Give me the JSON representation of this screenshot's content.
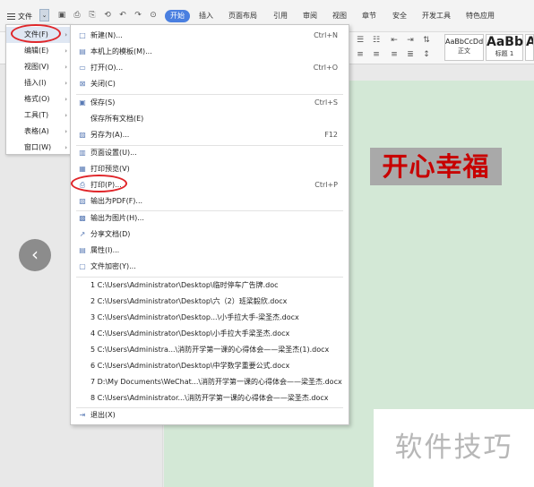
{
  "ribbon": {
    "menu_label": "文件",
    "dropdown_glyph": "⌄",
    "quick_access": [
      "▣",
      "⎙",
      "⎘",
      "⟲",
      "↶",
      "↷",
      "⊙"
    ],
    "tabs": [
      "开始",
      "插入",
      "页面布局",
      "引用",
      "审阅",
      "视图",
      "章节",
      "安全",
      "开发工具",
      "特色应用"
    ],
    "styles": [
      {
        "sample": "AaBbCcDd",
        "name": "正文"
      },
      {
        "sample": "AaBb",
        "name": "标题 1"
      },
      {
        "sample": "Aa",
        "name": ""
      }
    ]
  },
  "main_menu": {
    "items": [
      {
        "label": "文件(F)"
      },
      {
        "label": "编辑(E)"
      },
      {
        "label": "视图(V)"
      },
      {
        "label": "插入(I)"
      },
      {
        "label": "格式(O)"
      },
      {
        "label": "工具(T)"
      },
      {
        "label": "表格(A)"
      },
      {
        "label": "窗口(W)"
      }
    ],
    "arrow": "›"
  },
  "file_menu": {
    "items": [
      {
        "label": "新建(N)...",
        "shortcut": "Ctrl+N",
        "icon": "□"
      },
      {
        "label": "本机上的模板(M)...",
        "shortcut": "",
        "icon": "▤"
      },
      {
        "label": "打开(O)...",
        "shortcut": "Ctrl+O",
        "icon": "▭"
      },
      {
        "label": "关闭(C)",
        "shortcut": "",
        "icon": "⊠"
      },
      {
        "label": "保存(S)",
        "shortcut": "Ctrl+S",
        "icon": "▣"
      },
      {
        "label": "保存所有文档(E)",
        "shortcut": "",
        "icon": ""
      },
      {
        "label": "另存为(A)...",
        "shortcut": "F12",
        "icon": "▨"
      },
      {
        "label": "页面设置(U)...",
        "shortcut": "",
        "icon": "▥"
      },
      {
        "label": "打印预览(V)",
        "shortcut": "",
        "icon": "▦"
      },
      {
        "label": "打印(P)...",
        "shortcut": "Ctrl+P",
        "icon": "⎙"
      },
      {
        "label": "输出为PDF(F)...",
        "shortcut": "",
        "icon": "▧"
      },
      {
        "label": "输出为图片(H)...",
        "shortcut": "",
        "icon": "▩"
      },
      {
        "label": "分享文档(D)",
        "shortcut": "",
        "icon": "↗"
      },
      {
        "label": "属性(I)...",
        "shortcut": "",
        "icon": "▤"
      },
      {
        "label": "文件加密(Y)...",
        "shortcut": "",
        "icon": "▢"
      }
    ],
    "recent": [
      "1 C:\\Users\\Administrator\\Desktop\\临时停车广告牌.doc",
      "2 C:\\Users\\Administrator\\Desktop\\六（2）班梁毅欣.docx",
      "3 C:\\Users\\Administrator\\Desktop...\\小手拉大手-梁圣杰.docx",
      "4 C:\\Users\\Administrator\\Desktop\\小手拉大手梁圣杰.docx",
      "5 C:\\Users\\Administra...\\消防开学第一课的心得体会——梁圣杰(1).docx",
      "6 C:\\Users\\Administrator\\Desktop\\中学数学重要公式.docx",
      "7 D:\\My Documents\\WeChat...\\消防开学第一课的心得体会——梁圣杰.docx",
      "8 C:\\Users\\Administrator...\\消防开学第一课的心得体会——梁圣杰.docx"
    ],
    "exit": {
      "label": "退出(X)",
      "icon": "⇥"
    }
  },
  "document": {
    "heading": "开心幸福",
    "nav_button": "‹"
  },
  "watermark": "软件技巧",
  "colors": {
    "accent": "#4a7fe0",
    "doc_bg": "#d3e8d6",
    "heading_text": "#c80000",
    "highlight_circle": "#e0262a"
  }
}
